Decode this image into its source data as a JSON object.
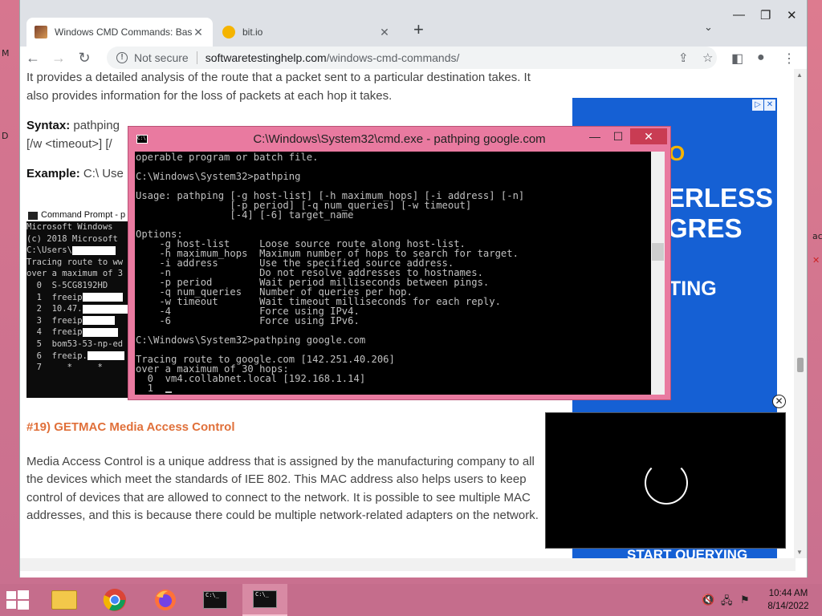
{
  "browser": {
    "tabs": [
      {
        "title": "Windows CMD Commands: Basic",
        "active": true
      },
      {
        "title": "bit.io",
        "active": false
      }
    ],
    "new_tab": "+",
    "security": "Not secure",
    "url_host": "softwaretestinghelp.com",
    "url_path": "/windows-cmd-commands/"
  },
  "article": {
    "intro": "It provides a detailed analysis of the route that a packet sent to a particular destination takes. It also provides information for the loss of packets at each hop it takes.",
    "syntax_label": "Syntax:",
    "syntax_start": "pathping",
    "syntax_line2": "[/w <timeout>] [/",
    "example_label": "Example:",
    "example_text": "C:\\ Use",
    "heading": "#19) GETMAC Media Access Control",
    "body": "Media Access Control is a unique address that is assigned by the manufacturing company to all the devices which meet the standards of IEE 802. This MAC address also helps users to keep control of devices that are allowed to connect to the network. It is possible to see multiple MAC addresses, and this is because there could be multiple network-related adapters on the network."
  },
  "screenshot_cmd": {
    "title": "Command Prompt - p",
    "lines": [
      "Microsoft Windows",
      "(c) 2018 Microsoft",
      "",
      "C:\\Users\\",
      "",
      "Tracing route to ww",
      "over a maximum of 3",
      "  0  ",
      "  1  freeip",
      "  2  10.47.",
      "  3  freeip",
      "  4  freeip",
      "  5  bom53-53-np-ed",
      "  6  freeip.",
      "  7     *     *"
    ],
    "redacted_host": "S-5CG8192HD"
  },
  "ad": {
    "line1": "O",
    "line2": "ERLESS",
    "line3": "GRES",
    "line4": "TING",
    "line5": "START QUERYING",
    "chips": [
      "▷",
      "✕"
    ]
  },
  "cmd": {
    "title": "C:\\Windows\\System32\\cmd.exe - pathping  google.com",
    "icon_text": "C:\\",
    "lines": [
      "operable program or batch file.",
      "",
      "C:\\Windows\\System32>pathping",
      "",
      "Usage: pathping [-g host-list] [-h maximum_hops] [-i address] [-n]",
      "                [-p period] [-q num_queries] [-w timeout]",
      "                [-4] [-6] target_name",
      "",
      "Options:",
      "    -g host-list     Loose source route along host-list.",
      "    -h maximum_hops  Maximum number of hops to search for target.",
      "    -i address       Use the specified source address.",
      "    -n               Do not resolve addresses to hostnames.",
      "    -p period        Wait period milliseconds between pings.",
      "    -q num_queries   Number of queries per hop.",
      "    -w timeout       Wait timeout milliseconds for each reply.",
      "    -4               Force using IPv4.",
      "    -6               Force using IPv6.",
      "",
      "C:\\Windows\\System32>pathping google.com",
      "",
      "Tracing route to google.com [142.251.40.206]",
      "over a maximum of 30 hops:",
      "  0  vm4.collabnet.local [192.168.1.14]",
      "  1  "
    ]
  },
  "taskbar": {
    "clock_time": "10:44 AM",
    "clock_date": "8/14/2022"
  },
  "colors": {
    "accent_orange": "#e0703a",
    "ad_blue": "#1560d4",
    "desktop_pink": "#c9708f",
    "cmd_border": "#e97aa0"
  }
}
